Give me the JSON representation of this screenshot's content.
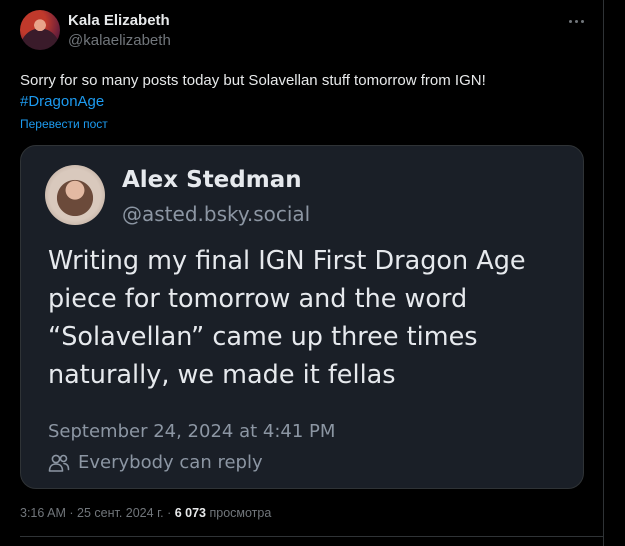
{
  "author": {
    "display_name": "Kala Elizabeth",
    "handle": "@kalaelizabeth",
    "avatar_icon": "avatar-photo"
  },
  "more_icon": "more-horizontal-icon",
  "post": {
    "text": "Sorry for so many posts today but Solavellan stuff tomorrow from IGN!",
    "hashtag": "#DragonAge",
    "translate_link": "Перевести пост"
  },
  "quoted_image": {
    "name": "Alex Stedman",
    "handle": "@asted.bsky.social",
    "text": "Writing my final IGN First Dragon Age piece for tomorrow and the word “Solavellan” came up three times naturally, we made it fellas",
    "date": "September 24, 2024 at 4:41 PM",
    "reply_setting": "Everybody can reply",
    "reply_icon": "people-icon"
  },
  "meta": {
    "time": "3:16 AM",
    "separator1": "·",
    "date": "25 сент. 2024 г.",
    "separator2": "·",
    "views_count": "6 073",
    "views_label": "просмотра"
  },
  "colors": {
    "background": "#000000",
    "text": "#e7e9ea",
    "secondary": "#71767b",
    "link": "#1d9bf0",
    "card": "#1a1f27"
  }
}
